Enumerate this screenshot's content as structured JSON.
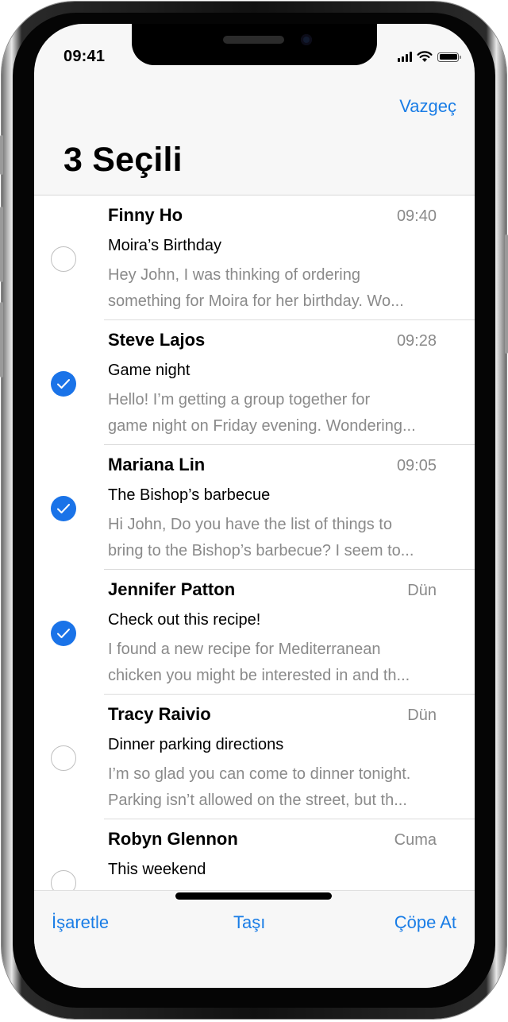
{
  "status_bar": {
    "time": "09:41",
    "icons": [
      "cellular-signal-icon",
      "wifi-icon",
      "battery-icon"
    ]
  },
  "nav": {
    "cancel_label": "Vazgeç",
    "title": "3 Seçili"
  },
  "messages": [
    {
      "sender": "Finny Ho",
      "time": "09:40",
      "subject": "Moira’s Birthday",
      "preview_line1": "Hey John, I was thinking of ordering",
      "preview_line2": "something for Moira for her birthday. Wo...",
      "selected": false
    },
    {
      "sender": "Steve Lajos",
      "time": "09:28",
      "subject": "Game night",
      "preview_line1": "Hello! I’m getting a group together for",
      "preview_line2": "game night on Friday evening. Wondering...",
      "selected": true
    },
    {
      "sender": "Mariana Lin",
      "time": "09:05",
      "subject": "The Bishop’s barbecue",
      "preview_line1": "Hi John, Do you have the list of things to",
      "preview_line2": "bring to the Bishop’s barbecue? I seem to...",
      "selected": true
    },
    {
      "sender": "Jennifer Patton",
      "time": "Dün",
      "subject": "Check out this recipe!",
      "preview_line1": "I found a new recipe for Mediterranean",
      "preview_line2": "chicken you might be interested in and th...",
      "selected": true
    },
    {
      "sender": "Tracy Raivio",
      "time": "Dün",
      "subject": "Dinner parking directions",
      "preview_line1": "I’m so glad you can come to dinner tonight.",
      "preview_line2": "Parking isn’t allowed on the street, but th...",
      "selected": false
    },
    {
      "sender": "Robyn Glennon",
      "time": "Cuma",
      "subject": "This weekend",
      "preview_line1": "",
      "preview_line2": "",
      "selected": false
    }
  ],
  "toolbar": {
    "mark_label": "İşaretle",
    "move_label": "Taşı",
    "trash_label": "Çöpe At"
  },
  "colors": {
    "accent": "#1a7de6",
    "checkbox_selected": "#1a73e8",
    "secondary_text": "#8a8a8a"
  }
}
